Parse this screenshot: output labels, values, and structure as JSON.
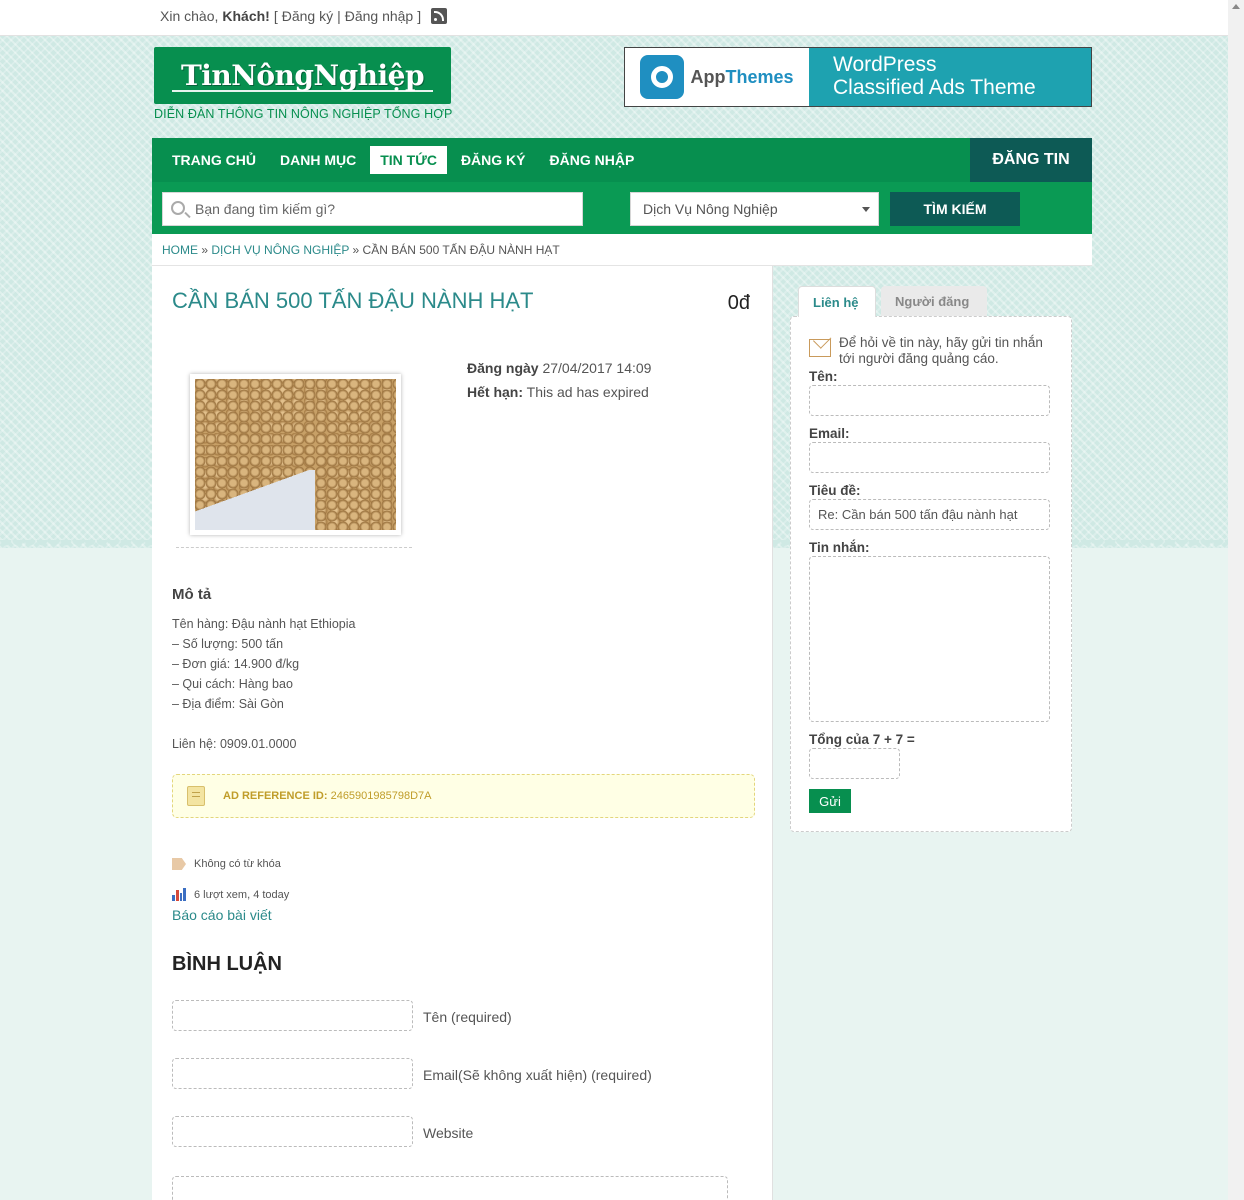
{
  "topbar": {
    "greeting": "Xin chào,",
    "user": "Khách!",
    "bracket_open": "[",
    "register": "Đăng ký",
    "separator": "|",
    "login": "Đăng nhập",
    "bracket_close": "]"
  },
  "header": {
    "logo_text": "TinNôngNghiệp",
    "tagline": "DIỄN ĐÀN THÔNG TIN NÔNG NGHIỆP TỔNG HỢP",
    "banner": {
      "brand_part1": "App",
      "brand_part2": "Themes",
      "line1": "WordPress",
      "line2": "Classified Ads Theme"
    }
  },
  "nav": {
    "items": [
      {
        "label": "TRANG CHỦ"
      },
      {
        "label": "DANH MỤC"
      },
      {
        "label": "TIN TỨC"
      },
      {
        "label": "ĐĂNG KÝ"
      },
      {
        "label": "ĐĂNG NHẬP"
      }
    ],
    "active_index": 2,
    "post_button": "ĐĂNG TIN"
  },
  "search": {
    "placeholder": "Bạn đang tìm kiếm gì?",
    "category": "Dịch Vụ Nông Nghiệp",
    "button": "TÌM KIẾM"
  },
  "breadcrumb": {
    "home": "HOME",
    "sep": "»",
    "category": "DỊCH VỤ NÔNG NGHIỆP",
    "current": "CẦN BÁN 500 TẤN ĐẬU NÀNH HẠT"
  },
  "ad": {
    "title": "CẦN BÁN 500 TẤN ĐẬU NÀNH HẠT",
    "price": "0đ",
    "posted_label": "Đăng ngày",
    "posted_value": "27/04/2017 14:09",
    "expires_label": "Hết hạn:",
    "expires_value": "This ad has expired",
    "description_heading": "Mô tả",
    "description_lines": [
      "Tên hàng: Đậu nành hạt Ethiopia",
      "– Số lượng: 500 tấn",
      "– Đơn giá: 14.900 đ/kg",
      "– Qui cách: Hàng bao",
      "– Địa điểm: Sài Gòn",
      "",
      "Liên hệ: 0909.01.0000"
    ],
    "ref_label": "AD REFERENCE ID:",
    "ref_value": "2465901985798D7A",
    "tags_text": "Không có từ khóa",
    "views_text": "6 lượt xem, 4 today",
    "report_link": "Báo cáo bài viết"
  },
  "comments": {
    "heading": "BÌNH LUẬN",
    "name_label": "Tên (required)",
    "email_label": "Email(Sẽ không xuất hiện) (required)",
    "website_label": "Website"
  },
  "sidebar": {
    "tab_contact": "Liên hệ",
    "tab_poster": "Người đăng",
    "intro": "Để hỏi về tin này, hãy gửi tin nhắn tới người đăng quảng cáo.",
    "name_label": "Tên:",
    "email_label": "Email:",
    "subject_label": "Tiêu đề:",
    "subject_value": "Re: Cần bán 500 tấn đậu nành hạt",
    "message_label": "Tin nhắn:",
    "captcha_label": "Tổng của 7 + 7 =",
    "send_button": "Gửi"
  },
  "colors": {
    "brand_green": "#078f4f",
    "dark_teal": "#0d5a55",
    "link_teal": "#2b8a8a"
  }
}
